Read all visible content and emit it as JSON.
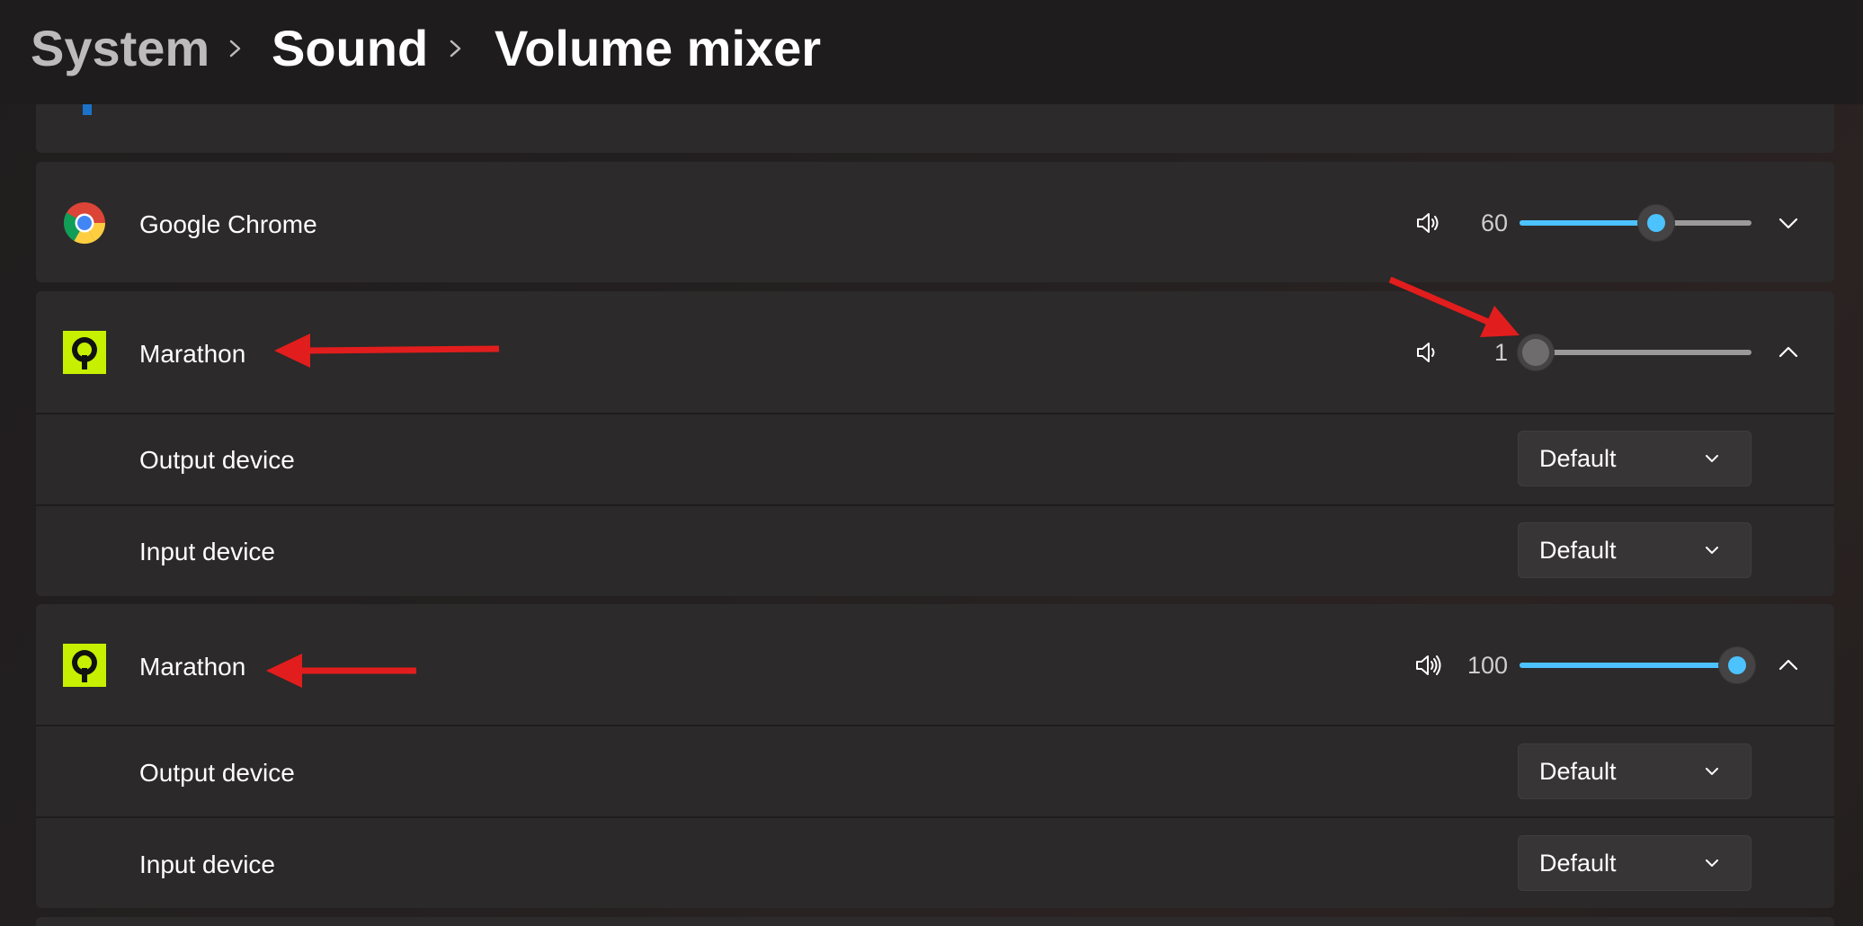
{
  "breadcrumb": {
    "items": [
      "System",
      "Sound",
      "Volume mixer"
    ]
  },
  "apps": [
    {
      "name": "Google Chrome",
      "icon": "chrome-icon",
      "volume": 60,
      "volume_text": "60",
      "expanded": false
    },
    {
      "name": "Marathon",
      "icon": "marathon-icon",
      "volume": 1,
      "volume_text": "1",
      "expanded": true,
      "output_label": "Output device",
      "output_value": "Default",
      "input_label": "Input device",
      "input_value": "Default"
    },
    {
      "name": "Marathon",
      "icon": "marathon-icon",
      "volume": 100,
      "volume_text": "100",
      "expanded": true,
      "output_label": "Output device",
      "output_value": "Default",
      "input_label": "Input device",
      "input_value": "Default"
    }
  ],
  "colors": {
    "accent": "#4cc2ff",
    "annotation_arrow": "#e21d1d",
    "marathon_brand": "#c6f000"
  }
}
